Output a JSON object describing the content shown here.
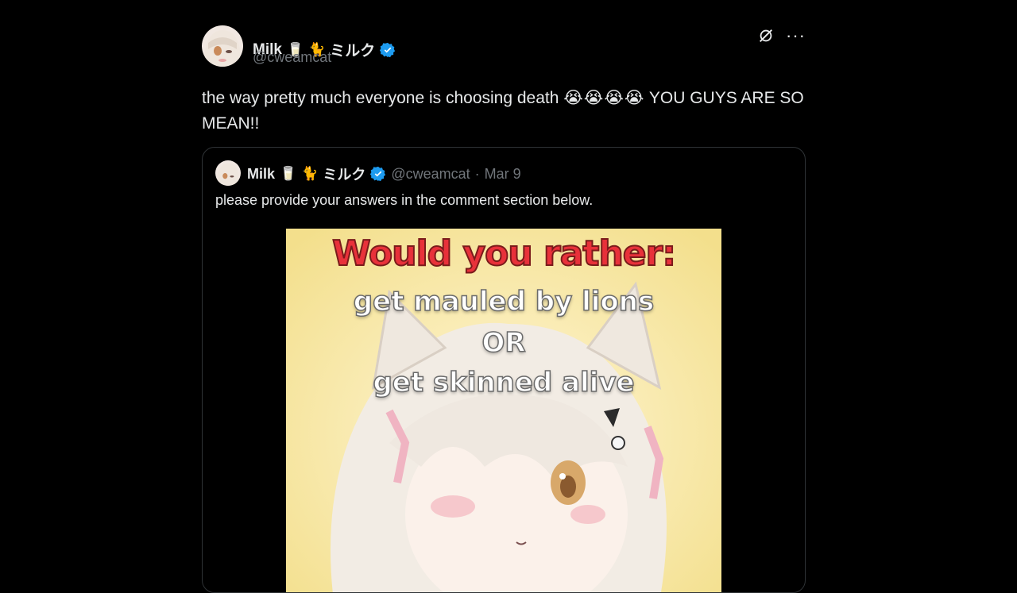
{
  "post": {
    "author_name": "Milk",
    "author_suffix": "ミルク",
    "author_handle": "@cweamcat",
    "text_before": "the way pretty much everyone is choosing death ",
    "emojis": "😭😭😭😭",
    "text_after": " YOU GUYS ARE SO MEAN!!"
  },
  "icons": {
    "glass": "🥛",
    "cat": "🐈",
    "verified": "verified-badge-icon",
    "grok": "grok-icon",
    "more": "more-options-icon"
  },
  "colors": {
    "verified_blue": "#1d9bf0",
    "muted": "#71767b",
    "title_red": "#e8313a"
  },
  "quote": {
    "author_name": "Milk",
    "author_suffix": "ミルク",
    "handle": "@cweamcat",
    "separator": "·",
    "date": "Mar 9",
    "text": "please provide your answers in the comment section below.",
    "image": {
      "title": "Would you rather:",
      "line1": "get mauled by lions",
      "line2": "OR",
      "line3": "get skinned alive"
    }
  },
  "top_actions": {
    "more_label": "···"
  }
}
